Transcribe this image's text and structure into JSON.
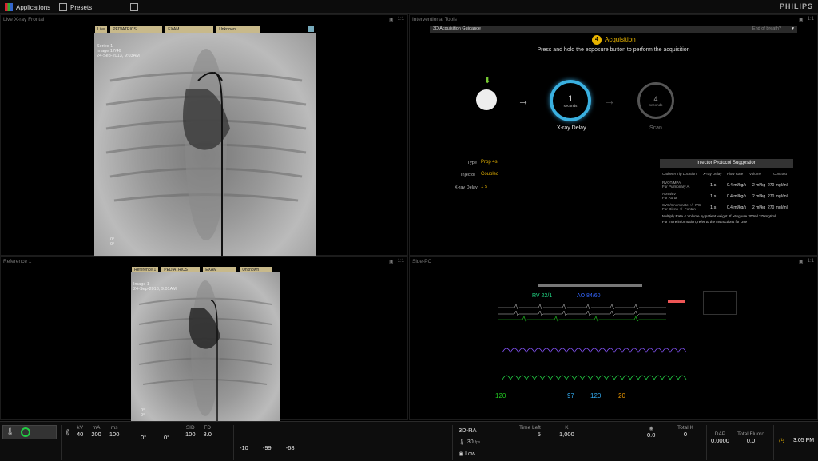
{
  "topbar": {
    "applications": "Applications",
    "presets": "Presets",
    "brand": "PHILIPS"
  },
  "panes": {
    "live_title": "Live X-ray Frontal",
    "interventional_title": "Interventional Tools",
    "reference_title": "Reference 1",
    "side_title": "Side-PC",
    "ctrl": "1:1"
  },
  "live": {
    "tags": [
      "Live",
      "PEDIATRICS",
      "EXAM",
      "Unknown"
    ],
    "series": "Series 1",
    "image": "Image 17/46",
    "date": "24-Sep-2013, 9:03AM",
    "corner_a": "0°",
    "corner_b": "0°"
  },
  "reference": {
    "tags": [
      "Reference 1",
      "PEDIATRICS",
      "EXAM",
      "Unknown"
    ],
    "line1": "Image 1",
    "line2": "24-Sep-2013, 9:01AM",
    "corner_a": "0°",
    "corner_b": "0°"
  },
  "guidance": {
    "header": "3D Acquisition Guidance",
    "header_right": "End of breath?",
    "step_num": "4",
    "step_title": "Acquisition",
    "instruction": "Press and hold the exposure button to perform the acquisition",
    "delay_value": "1",
    "delay_unit": "seconds",
    "delay_label": "X-ray Delay",
    "scan_value": "4",
    "scan_unit": "seconds",
    "scan_label": "Scan",
    "type_label": "Type",
    "type_value": "Prop 4s",
    "injector_label": "Injector",
    "injector_value": "Coupled",
    "xray_delay_label": "X-ray Delay",
    "xray_delay_value": "1 s"
  },
  "injector": {
    "title": "Injector Protocol Suggestion",
    "headers": [
      "Catheter Tip Location",
      "X-ray Delay",
      "Flow Rate",
      "Volume",
      "Contrast"
    ],
    "rows": [
      {
        "loc1": "RVOT/MPA",
        "loc2": "For Pulmonary A.",
        "delay": "1 s",
        "flow": "0.4 ml/kg/s",
        "vol": "2 ml/kg",
        "contrast": "270 mgI/ml"
      },
      {
        "loc1": "Aorta/LV",
        "loc2": "For Aorta",
        "delay": "1 s",
        "flow": "0.4 ml/kg/s",
        "vol": "2 ml/kg",
        "contrast": "270 mgI/ml"
      },
      {
        "loc1": "SVC/Innominate +/- IVC",
        "loc2": "For Glenn +/- Fontan",
        "delay": "1 s",
        "flow": "0.4 ml/kg/s",
        "vol": "2 ml/kg",
        "contrast": "270 mgI/ml"
      }
    ],
    "note1": "Multiply Rate & Volume by patient weight. If ~5kg use 300ml 370mgI/ml",
    "note2": "For more information, refer to the Instructions for Use"
  },
  "monitor": {
    "rv": "RV  22/1",
    "ao": "AO  84/60",
    "hr": "120",
    "spo2": "97",
    "pulse": "120",
    "resp": "20"
  },
  "status": {
    "kv_label": "kV",
    "kv": "40",
    "ma_label": "mA",
    "ma": "200",
    "ms_label": "ms",
    "ms": "100",
    "ang1": "0°",
    "ang2": "0°",
    "sid_label": "SID",
    "sid": "100",
    "fd_label": "FD",
    "fd": "8.0",
    "t1": "-10",
    "t2": "-99",
    "t3": "-68",
    "mode": "3D-RA",
    "fps": "30",
    "fps_unit": "fps",
    "dose": "Low",
    "time_left_label": "Time Left",
    "time_left": "5",
    "k_label": "K",
    "k_value": "1,000",
    "rate": "0.0",
    "total_k_label": "Total K",
    "total_k": "0",
    "dap_label": "DAP",
    "dap": "0.0000",
    "fluoro_label": "Total Fluoro",
    "fluoro": "0.0",
    "clock": "3:05 PM"
  }
}
